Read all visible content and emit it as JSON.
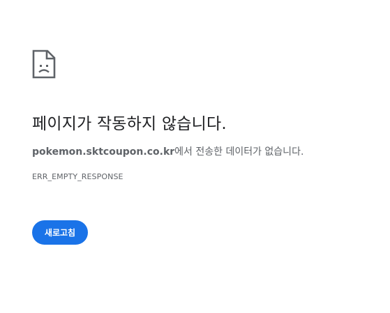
{
  "error_page": {
    "icon": "sad-page-icon",
    "title": "페이지가 작동하지 않습니다.",
    "summary": {
      "host": "pokemon.sktcoupon.co.kr",
      "message": "에서 전송한 데이터가 없습니다."
    },
    "error_code": "ERR_EMPTY_RESPONSE",
    "reload_label": "새로고침",
    "colors": {
      "accent": "#1a73e8",
      "title_text": "#202124",
      "secondary_text": "#5f6368",
      "icon": "#5f6368"
    }
  }
}
